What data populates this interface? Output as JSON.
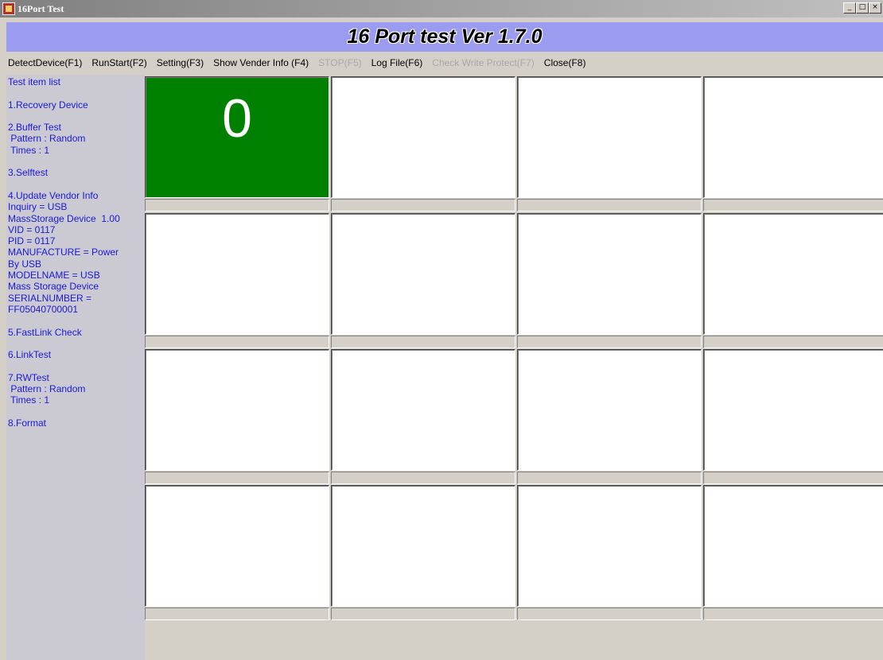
{
  "window": {
    "title": "16Port Test"
  },
  "banner": {
    "title": "16 Port test Ver 1.7.0"
  },
  "colors": {
    "banner_bg": "#9b9bf0",
    "active_port": "#008000",
    "list_text": "#1a1ad6",
    "disabled_menu": "#a8a8a8"
  },
  "menu": [
    {
      "label": "DetectDevice(F1)",
      "enabled": true
    },
    {
      "label": "RunStart(F2)",
      "enabled": true
    },
    {
      "label": "Setting(F3)",
      "enabled": true
    },
    {
      "label": "Show Vender Info (F4)",
      "enabled": true
    },
    {
      "label": "STOP(F5)",
      "enabled": false
    },
    {
      "label": "Log File(F6)",
      "enabled": true
    },
    {
      "label": "Check Write Protect(F7)",
      "enabled": false
    },
    {
      "label": "Close(F8)",
      "enabled": true
    }
  ],
  "test_list": [
    "Test item list",
    "",
    "1.Recovery Device",
    "",
    "2.Buffer Test",
    " Pattern : Random",
    " Times : 1",
    "",
    "3.Selftest",
    "",
    "4.Update Vendor Info",
    "Inquiry = USB",
    "MassStorage Device  1.00",
    "VID = 0117",
    "PID = 0117",
    "MANUFACTURE = Power",
    "By USB",
    "MODELNAME = USB",
    "Mass Storage Device",
    "SERIALNUMBER =",
    "FF05040700001",
    "",
    "5.FastLink Check",
    "",
    "6.LinkTest",
    "",
    "7.RWTest",
    " Pattern : Random",
    " Times : 1",
    "",
    "8.Format"
  ],
  "ports": [
    {
      "label": "0",
      "active": true
    },
    {
      "label": "",
      "active": false
    },
    {
      "label": "",
      "active": false
    },
    {
      "label": "",
      "active": false
    },
    {
      "label": "",
      "active": false
    },
    {
      "label": "",
      "active": false
    },
    {
      "label": "",
      "active": false
    },
    {
      "label": "",
      "active": false
    },
    {
      "label": "",
      "active": false
    },
    {
      "label": "",
      "active": false
    },
    {
      "label": "",
      "active": false
    },
    {
      "label": "",
      "active": false
    },
    {
      "label": "",
      "active": false
    },
    {
      "label": "",
      "active": false
    },
    {
      "label": "",
      "active": false
    },
    {
      "label": "",
      "active": false
    }
  ]
}
